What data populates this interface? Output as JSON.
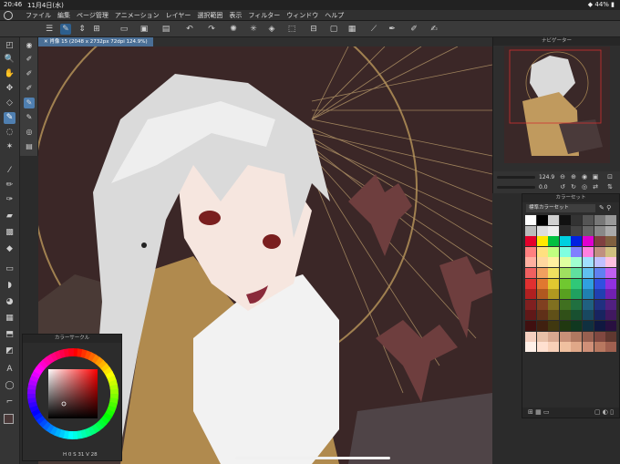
{
  "status_bar": {
    "time": "20:46",
    "date": "11月4日(水)",
    "battery": "44%"
  },
  "menu": {
    "items": [
      "ファイル",
      "編集",
      "ページ管理",
      "アニメーション",
      "レイヤー",
      "選択範囲",
      "表示",
      "フィルター",
      "ウィンドウ",
      "ヘルプ"
    ]
  },
  "document": {
    "tab_label": "肖像 15 (2048 x 2732px 72dpi 124.9%)"
  },
  "navigator": {
    "title": "ナビゲーター",
    "zoom": "124.9",
    "rotation": "0.0"
  },
  "color_set": {
    "title": "カラーセット",
    "set_name": "標準カラーセット",
    "swatches": [
      "#ffffff",
      "#000000",
      "#d0d0d0",
      "#111111",
      "#333333",
      "#555555",
      "#777777",
      "#999999",
      "#bbbbbb",
      "#dddddd",
      "#eeeeee",
      "#2a2a2a",
      "#444444",
      "#666666",
      "#888888",
      "#aaaaaa",
      "#e4002b",
      "#ffe800",
      "#00c040",
      "#00d0e0",
      "#0020e0",
      "#e000d0",
      "#804040",
      "#806040",
      "#ff8080",
      "#ffe080",
      "#c0ff80",
      "#80ffe0",
      "#8080ff",
      "#ff80e0",
      "#c09080",
      "#d0c080",
      "#ffb0a0",
      "#ffd8a0",
      "#fff0a0",
      "#e0ffa0",
      "#a0ffd0",
      "#a0e0ff",
      "#c0c0ff",
      "#ffc0e0",
      "#f06060",
      "#f0a060",
      "#f0e060",
      "#a0e060",
      "#60e0a0",
      "#60c0f0",
      "#6080f0",
      "#c060f0",
      "#e03030",
      "#e07830",
      "#e0c830",
      "#70c830",
      "#30c878",
      "#30a0e0",
      "#3050e0",
      "#9030e0",
      "#b02020",
      "#b05820",
      "#b09820",
      "#58a020",
      "#20a060",
      "#2080b0",
      "#2040b0",
      "#7020b0",
      "#802020",
      "#804020",
      "#807020",
      "#407020",
      "#207040",
      "#206080",
      "#203080",
      "#502080",
      "#601818",
      "#603018",
      "#605018",
      "#305018",
      "#185030",
      "#184860",
      "#182460",
      "#401860",
      "#401010",
      "#402010",
      "#403810",
      "#203810",
      "#103820",
      "#103040",
      "#101840",
      "#281040",
      "#f5d0c0",
      "#e8c0a8",
      "#d8a890",
      "#c89078",
      "#b07860",
      "#986050",
      "#804840",
      "#603830",
      "#fff0e8",
      "#ffe0d0",
      "#f8d0b8",
      "#f0c0a0",
      "#e0a888",
      "#d09078",
      "#b87860",
      "#a06050"
    ]
  },
  "color_wheel": {
    "title": "カラーサークル",
    "h": "0",
    "s": "31",
    "v": "28"
  },
  "colors": {
    "main": "#4a3838",
    "sub": "#ffffff",
    "accent": "#4f7fb0"
  },
  "toolbar_icons": [
    "menu-icon",
    "pen-icon",
    "updown-icon",
    "mirror-icon",
    "clear-icon",
    "save-icon",
    "undo-icon",
    "redo-icon",
    "settings-icon",
    "spinner-icon",
    "fill-icon",
    "transform-icon",
    "select-icon",
    "deselect-icon",
    "invert-icon",
    "rect-select-icon",
    "line-icon",
    "brush-icon",
    "pen2-icon",
    "edit-icon"
  ]
}
